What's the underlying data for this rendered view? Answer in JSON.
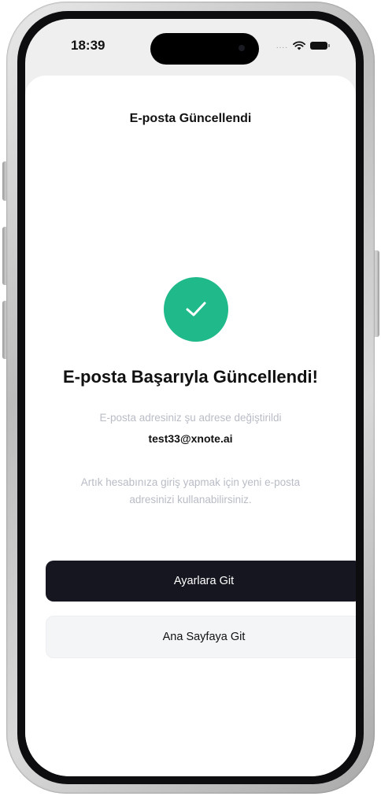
{
  "status_bar": {
    "time": "18:39",
    "signal_dots": "....",
    "icons": [
      "wifi-icon",
      "battery-icon"
    ]
  },
  "header": {
    "title": "E-posta Güncellendi"
  },
  "main": {
    "icon": "checkmark-icon",
    "accent_color": "#1fb98a",
    "headline": "E-posta Başarıyla Güncellendi!",
    "description": "E-posta adresiniz şu adrese değiştirildi",
    "new_email": "test33@xnote.ai",
    "info": "Artık hesabınıza giriş yapmak için yeni e-posta adresinizi kullanabilirsiniz."
  },
  "actions": {
    "primary_label": "Ayarlara Git",
    "secondary_label": "Ana Sayfaya Git"
  }
}
